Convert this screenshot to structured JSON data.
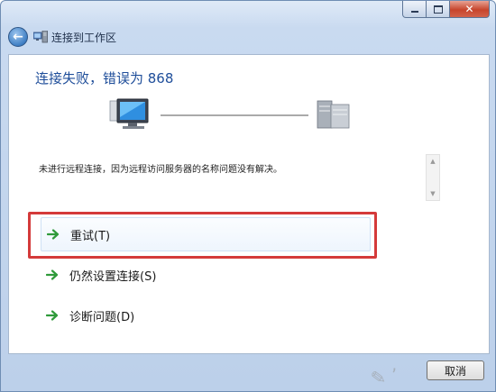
{
  "window": {
    "title": "连接到工作区"
  },
  "header": {
    "error_heading": "连接失败，错误为 868"
  },
  "message": {
    "text": "未进行远程连接，因为远程访问服务器的名称问题没有解决。"
  },
  "options": {
    "retry": "重试(T)",
    "set_up_anyway": "仍然设置连接(S)",
    "diagnose": "诊断问题(D)"
  },
  "buttons": {
    "cancel": "取消"
  },
  "colors": {
    "heading_blue": "#1f4e9a",
    "highlight_red": "#d43a3a",
    "arrow_green": "#2f9a3a"
  },
  "icons": [
    "back-arrow-icon",
    "workplace-network-icon",
    "computer-icon",
    "server-icon",
    "green-arrow-icon"
  ]
}
